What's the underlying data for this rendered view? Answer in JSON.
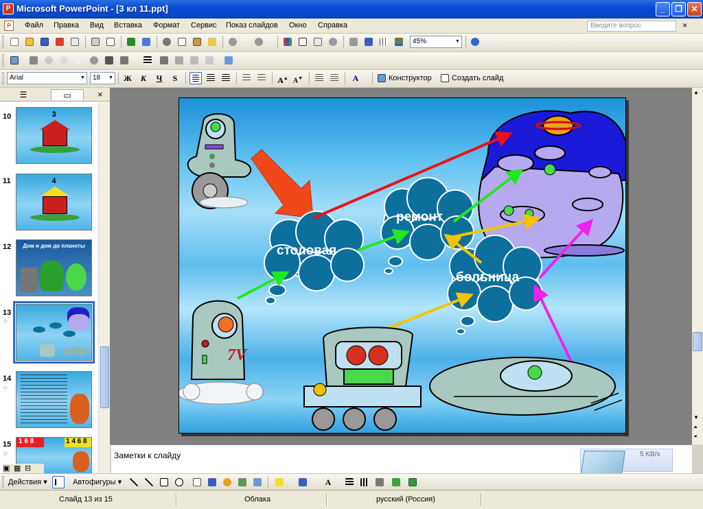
{
  "window": {
    "title": "Microsoft PowerPoint - [3 кл 11.ppt]",
    "minimize": "_",
    "maximize": "❐",
    "close": "✕"
  },
  "menu": {
    "items": [
      "Файл",
      "Правка",
      "Вид",
      "Вставка",
      "Формат",
      "Сервис",
      "Показ слайдов",
      "Окно",
      "Справка"
    ],
    "ask_placeholder": "Введите вопрос",
    "close_doc": "×"
  },
  "toolbar": {
    "zoom": "45%"
  },
  "format": {
    "font": "Arial",
    "size": "18",
    "bold": "Ж",
    "italic": "К",
    "underline": "Ч",
    "shadow": "S",
    "designer": "Конструктор",
    "new_slide": "Создать слайд"
  },
  "left_pane": {
    "outline_tab_icon": "outline-icon",
    "slides_tab_icon": "slides-icon",
    "close": "×",
    "slides": [
      {
        "num": "10",
        "label": "3"
      },
      {
        "num": "11",
        "label": "4"
      },
      {
        "num": "12",
        "label": "Дом и дом до планеты"
      },
      {
        "num": "13",
        "label": ""
      },
      {
        "num": "14",
        "label": ""
      },
      {
        "num": "15",
        "label": "1 6 8"
      }
    ],
    "slide15_right": "1 4 6 8"
  },
  "slide": {
    "cloud_canteen": "столовая",
    "cloud_repair": "ремонт",
    "cloud_hospital": "больница",
    "rover_plate": "7V",
    "colors": {
      "cloud": "#0d6f9c",
      "green_arrow": "#22e822",
      "red_arrow": "#ee1111",
      "yellow_arrow": "#f5c400",
      "magenta_arrow": "#ee22ee",
      "big_arrow": "#f04818",
      "planet_purple": "#b7a9ef",
      "dome_blue": "#1a1ad8"
    }
  },
  "notes": {
    "placeholder": "Заметки к слайду"
  },
  "network": {
    "speed": "5 KB/s"
  },
  "draw": {
    "actions": "Действия",
    "autoshapes": "Автофигуры"
  },
  "status": {
    "slide": "Слайд 13 из 15",
    "design": "Облака",
    "language": "русский (Россия)"
  }
}
